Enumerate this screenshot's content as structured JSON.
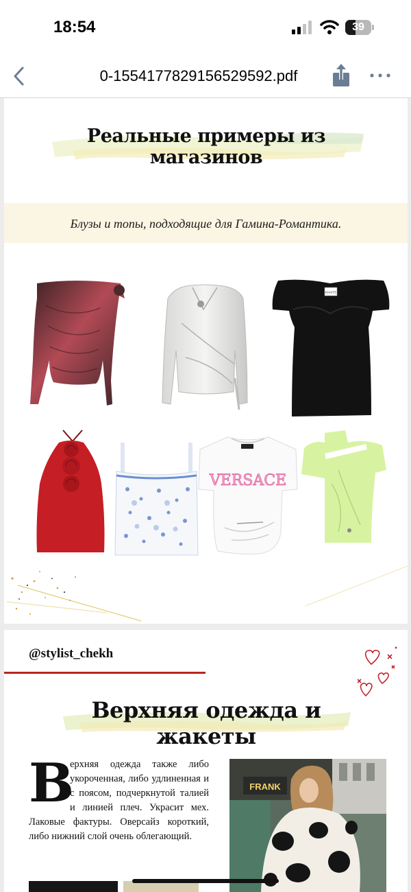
{
  "status_bar": {
    "time": "18:54",
    "battery_level": "39",
    "battery_fraction": 0.39,
    "icons": [
      "cellular-signal-icon",
      "wifi-icon",
      "battery-icon"
    ]
  },
  "nav": {
    "title": "0-1554177829156529592.pdf",
    "icons": [
      "chevron-left-icon",
      "share-icon",
      "more-icon"
    ]
  },
  "page1": {
    "heading": "Реальные примеры из магазинов",
    "subtitle": "Блузы и топы, подходящие для Гамина-Романтика.",
    "tshirt_print": "VERSACE",
    "label_tag": "KHAITE",
    "garments": [
      "burgundy-off-shoulder-top",
      "silver-satin-wrap-blouse",
      "black-sweetheart-top",
      "red-rose-halter-top",
      "floral-corset-top",
      "versace-tshirt",
      "lime-mesh-top"
    ]
  },
  "page2": {
    "handle": "@stylist_chekh",
    "heading": "Верхняя одежда и жакеты",
    "dropcap": "В",
    "body": "ерхняя одежда также либо укороченная, либо удлиненная и с поясом, подчеркнутой талией и линией плеч. Украсит мех. Лаковые фактуры. Оверсайз короткий, либо нижний слой очень облегающий.",
    "photo_sign": "FRANK"
  },
  "colors": {
    "accent_red": "#b8261f",
    "band_cream": "#fbf5e3",
    "brush_green": "#e3efc2",
    "brush_yellow": "#f6ecb0"
  }
}
